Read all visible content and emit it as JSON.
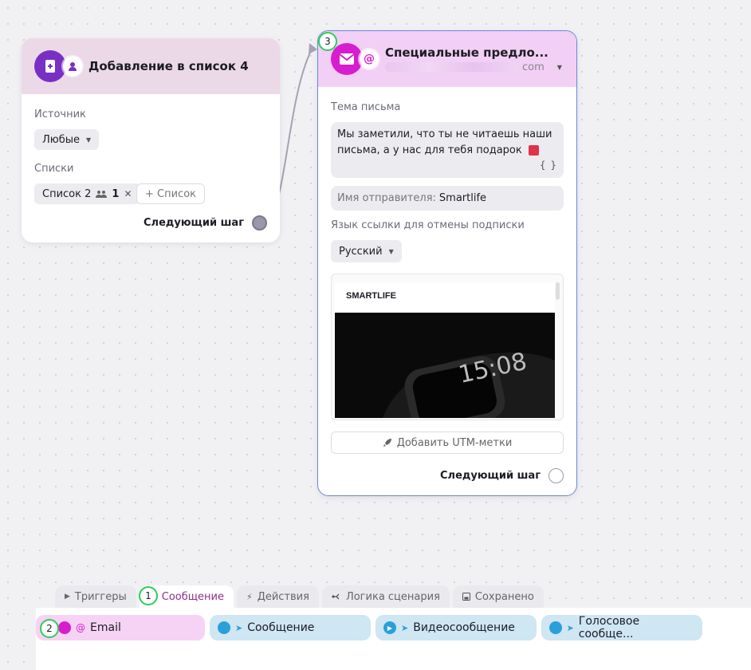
{
  "card_list": {
    "title": "Добавление в список 4",
    "source_label": "Источник",
    "source_value": "Любые",
    "lists_label": "Списки",
    "list_chip_name": "Список 2",
    "list_chip_count": "1",
    "add_list_label": "+ Список",
    "next_step": "Следующий шаг"
  },
  "card_email": {
    "title": "Специальные предло...",
    "sender_suffix": "com",
    "subject_label": "Тема письма",
    "subject_text": "Мы заметили, что ты не читаешь наши письма, а у нас для тебя подарок",
    "var_button": "{ }",
    "sender_name_label": "Имя отправителя:",
    "sender_name_value": "Smartlife",
    "unsub_label": "Язык ссылки для отмены подписки",
    "lang_value": "Русский",
    "preview_brand": "SMARTLIFE",
    "watch_time": "15:08",
    "utm_button": "Добавить UTM-метки",
    "next_step": "Следующий шаг"
  },
  "badges": {
    "one": "1",
    "two": "2",
    "three": "3"
  },
  "tabs": [
    {
      "label": "Триггеры"
    },
    {
      "label": "Сообщение"
    },
    {
      "label": "Действия"
    },
    {
      "label": "Логика сценария"
    },
    {
      "label": "Сохранено"
    }
  ],
  "channels": [
    {
      "label": "Email"
    },
    {
      "label": "Сообщение"
    },
    {
      "label": "Видеосообщение"
    },
    {
      "label": "Голосовое сообще..."
    }
  ],
  "colors": {
    "purple_accent": "#7a2fc4",
    "magenta_accent": "#d81ccf",
    "telegram_blue": "#2a9fd9",
    "badge_green": "#2ecc5a",
    "selected_border": "#6b86d6"
  },
  "icons": {
    "list_card": [
      "add-to-list-icon",
      "user-icon"
    ],
    "email_card": [
      "envelope-icon",
      "at-icon"
    ]
  }
}
